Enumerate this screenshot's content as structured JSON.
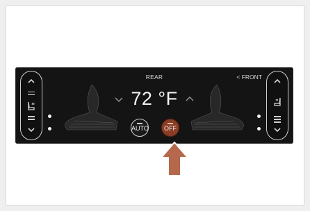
{
  "panel": {
    "rear_label": "REAR",
    "front_label": "< FRONT",
    "temperature": "72 °F",
    "auto_label": "AUTO",
    "off_label": "OFF"
  },
  "colors": {
    "panel_bg": "#141414",
    "off_button": "#8a3c24",
    "pointer_arrow": "#b5684c"
  },
  "icons": {
    "left_pill": [
      "chevron-up-icon",
      "heated-seat-icon",
      "chevron-down-icon"
    ],
    "right_pill": [
      "chevron-up-icon",
      "ventilated-seat-icon",
      "chevron-down-icon"
    ],
    "temperature": [
      "chevron-down-icon",
      "chevron-up-icon"
    ],
    "pointer": "pointer-arrow-icon"
  }
}
